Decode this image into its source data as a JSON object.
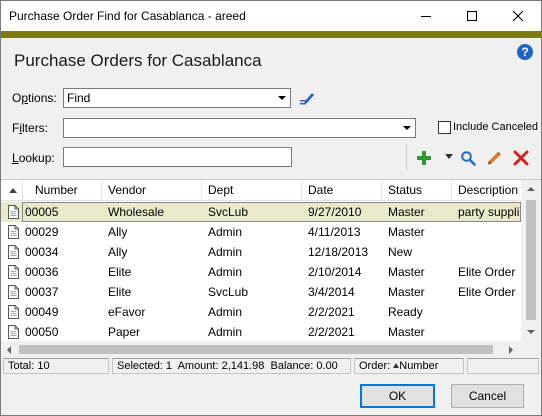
{
  "window": {
    "title": "Purchase Order Find for Casablanca - areed"
  },
  "heading": "Purchase Orders for Casablanca",
  "options": {
    "label_pre": "O",
    "label_ul": "p",
    "label_post": "tions:",
    "value": "Find"
  },
  "filters": {
    "label_pre": "F",
    "label_ul": "i",
    "label_post": "lters:",
    "value": ""
  },
  "include_canceled": {
    "label": "Include Canceled",
    "checked": false
  },
  "lookup": {
    "label_pre": "",
    "label_ul": "L",
    "label_post": "ookup:",
    "value": ""
  },
  "toolbar": {
    "icons": [
      "add-icon",
      "dropdown-arrow-icon",
      "search-icon",
      "edit-pencil-icon",
      "delete-x-icon"
    ],
    "colors": {
      "add": "#2e9b2e",
      "search": "#1f6fcf",
      "edit": "#e07a1c",
      "delete": "#d42020"
    }
  },
  "grid": {
    "columns": [
      "Number",
      "Vendor",
      "Dept",
      "Date",
      "Status",
      "Description"
    ],
    "rows": [
      {
        "number": "00005",
        "vendor": "Wholesale",
        "dept": "SvcLub",
        "date": "9/27/2010",
        "status": "Master",
        "description": "party suppli"
      },
      {
        "number": "00029",
        "vendor": "Ally",
        "dept": "Admin",
        "date": "4/11/2013",
        "status": "Master",
        "description": ""
      },
      {
        "number": "00034",
        "vendor": "Ally",
        "dept": "Admin",
        "date": "12/18/2013",
        "status": "New",
        "description": ""
      },
      {
        "number": "00036",
        "vendor": "Elite",
        "dept": "Admin",
        "date": "2/10/2014",
        "status": "Master",
        "description": "Elite Order"
      },
      {
        "number": "00037",
        "vendor": "Elite",
        "dept": "SvcLub",
        "date": "3/4/2014",
        "status": "Master",
        "description": "Elite Order"
      },
      {
        "number": "00049",
        "vendor": "eFavor",
        "dept": "Admin",
        "date": "2/2/2021",
        "status": "Ready",
        "description": ""
      },
      {
        "number": "00050",
        "vendor": "Paper",
        "dept": "Admin",
        "date": "2/2/2021",
        "status": "Master",
        "description": ""
      }
    ],
    "selected_index": 0,
    "selected_color": "#eaeacb"
  },
  "status": {
    "total": "Total: 10",
    "selected": "Selected: 1",
    "amount": "Amount: 2,141.98",
    "balance": "Balance: 0.00",
    "order_label": "Order:",
    "order_value": "Number"
  },
  "buttons": {
    "ok": "OK",
    "cancel": "Cancel"
  },
  "accent_color": "#7e7a12"
}
